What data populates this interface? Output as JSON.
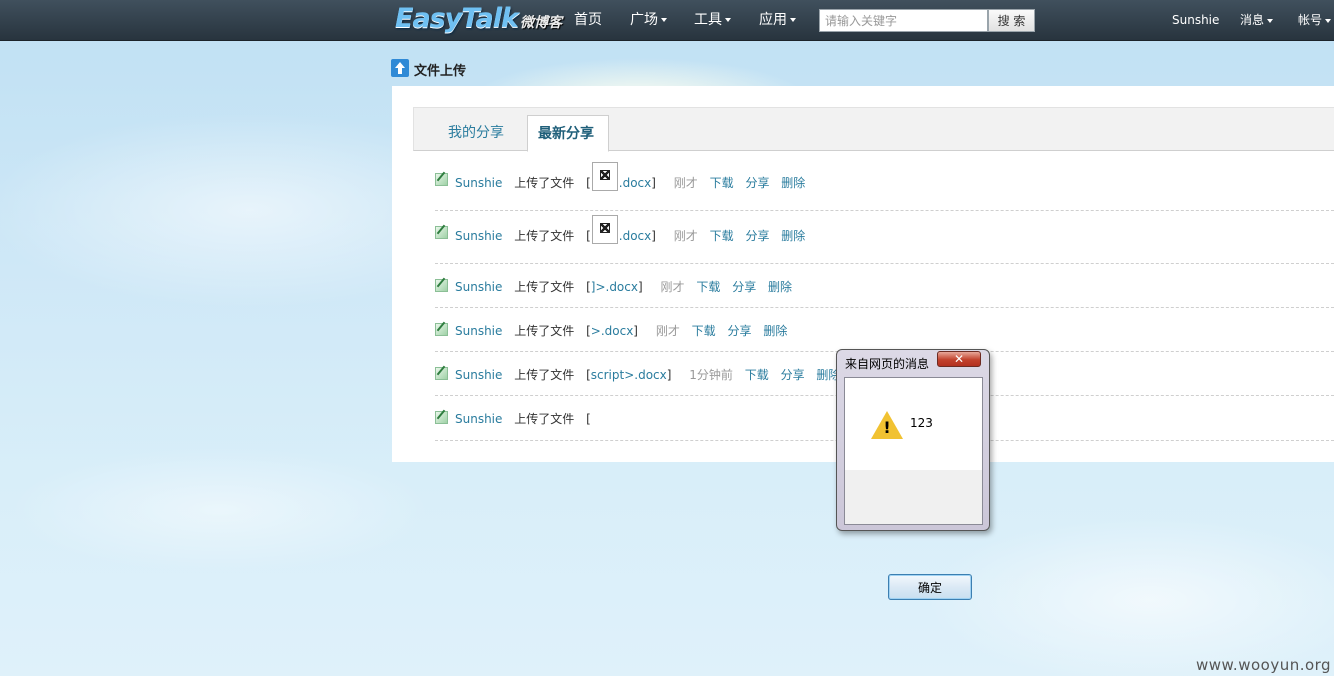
{
  "header": {
    "logo_main": "EasyTalk",
    "logo_sub": "微博客",
    "nav": [
      {
        "label": "首页",
        "dropdown": false
      },
      {
        "label": "广场",
        "dropdown": true
      },
      {
        "label": "工具",
        "dropdown": true
      },
      {
        "label": "应用",
        "dropdown": true
      }
    ],
    "search_placeholder": "请输入关键字",
    "search_button": "搜 索",
    "user": "Sunshie",
    "messages": "消息",
    "account": "帐号"
  },
  "page": {
    "title": "文件上传",
    "tabs": [
      {
        "label": "我的分享",
        "active": false
      },
      {
        "label": "最新分享",
        "active": true
      }
    ]
  },
  "items": [
    {
      "user": "Sunshie",
      "action": "上传了文件",
      "pre": "[",
      "broken_image": true,
      "file": ".docx",
      "post": "]",
      "time": "刚才",
      "download": "下载",
      "share": "分享",
      "delete": "删除"
    },
    {
      "user": "Sunshie",
      "action": "上传了文件",
      "pre": "[",
      "broken_image": true,
      "file": ".docx",
      "post": "]",
      "time": "刚才",
      "download": "下载",
      "share": "分享",
      "delete": "删除"
    },
    {
      "user": "Sunshie",
      "action": "上传了文件",
      "pre": "[",
      "broken_image": false,
      "file": "]>.docx",
      "post": "]",
      "time": "刚才",
      "download": "下载",
      "share": "分享",
      "delete": "删除"
    },
    {
      "user": "Sunshie",
      "action": "上传了文件",
      "pre": "[",
      "broken_image": false,
      "file": ">.docx",
      "post": "]",
      "time": "刚才",
      "download": "下载",
      "share": "分享",
      "delete": "删除"
    },
    {
      "user": "Sunshie",
      "action": "上传了文件",
      "pre": "[",
      "broken_image": false,
      "file": "script>.docx",
      "post": "]",
      "time": "1分钟前",
      "download": "下载",
      "share": "分享",
      "delete": "删除"
    },
    {
      "user": "Sunshie",
      "action": "上传了文件",
      "pre": "[",
      "broken_image": false,
      "file": "",
      "post": "",
      "time": "",
      "download": "",
      "share": "",
      "delete": ""
    }
  ],
  "dialog": {
    "title": "来自网页的消息",
    "close": "✕",
    "message": "123",
    "ok": "确定",
    "icon": "warning-icon"
  },
  "watermark": "www.wooyun.org"
}
